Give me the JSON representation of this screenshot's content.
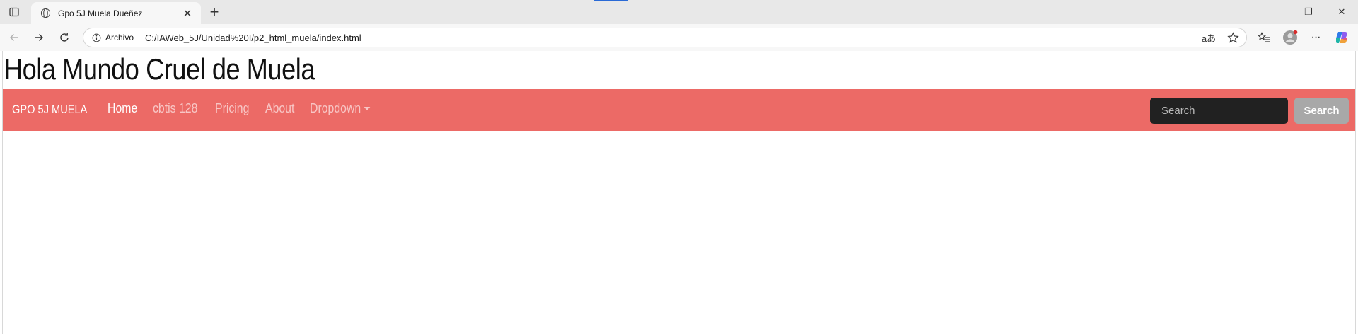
{
  "browser": {
    "tab": {
      "title": "Gpo 5J Muela Dueñez",
      "close_glyph": "✕"
    },
    "new_tab_glyph": "+",
    "address_bar": {
      "scheme_label": "Archivo",
      "url": "C:/IAWeb_5J/Unidad%20I/p2_html_muela/index.html"
    },
    "icons": {
      "tab_actions": "tab-actions-icon",
      "favicon": "globe-icon",
      "back": "back-arrow-icon",
      "forward": "forward-arrow-icon",
      "refresh": "refresh-icon",
      "site_info": "info-icon",
      "read_aloud": "read-aloud-icon",
      "favorite": "star-icon",
      "favorites": "favorites-icon",
      "profile": "profile-icon",
      "more": "more-icon",
      "copilot": "copilot-icon"
    },
    "window_controls": {
      "minimize": "—",
      "restore": "❐",
      "close": "✕"
    },
    "read_aloud_glyph": "aあ",
    "more_glyph": "···"
  },
  "page": {
    "heading": "Hola Mundo Cruel de Muela",
    "navbar": {
      "brand": "GPO 5J MUELA",
      "links": [
        {
          "label": "Home",
          "active": true
        },
        {
          "label": "cbtis 128",
          "active": false
        },
        {
          "label": "Pricing",
          "active": false
        },
        {
          "label": "About",
          "active": false
        },
        {
          "label": "Dropdown",
          "active": false
        }
      ],
      "search_placeholder": "Search",
      "search_button": "Search"
    },
    "colors": {
      "navbar_bg": "#ec6a66",
      "search_input_bg": "#212121",
      "search_button_bg": "#a8a8a8"
    }
  }
}
